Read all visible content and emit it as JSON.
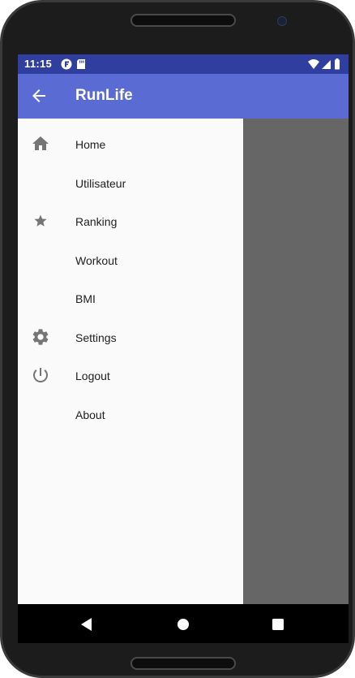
{
  "status_bar": {
    "time": "11:15",
    "left_icons": [
      "app-notification-icon",
      "sd-card-icon"
    ],
    "right_icons": [
      "wifi-icon",
      "signal-icon",
      "battery-icon"
    ],
    "color": "#303f9f"
  },
  "app_bar": {
    "title": "RunLife",
    "back_icon": "arrow-back-icon",
    "color": "#5b6bd4"
  },
  "drawer": {
    "items": [
      {
        "label": "Home",
        "icon": "home-icon"
      },
      {
        "label": "Utilisateur",
        "icon": ""
      },
      {
        "label": "Ranking",
        "icon": "star-icon"
      },
      {
        "label": "Workout",
        "icon": ""
      },
      {
        "label": "BMI",
        "icon": ""
      },
      {
        "label": "Settings",
        "icon": "gear-icon"
      },
      {
        "label": "Logout",
        "icon": "power-icon"
      },
      {
        "label": "About",
        "icon": ""
      }
    ]
  },
  "nav_bar": {
    "buttons": [
      "back-triangle-icon",
      "home-circle-icon",
      "recents-square-icon"
    ]
  }
}
